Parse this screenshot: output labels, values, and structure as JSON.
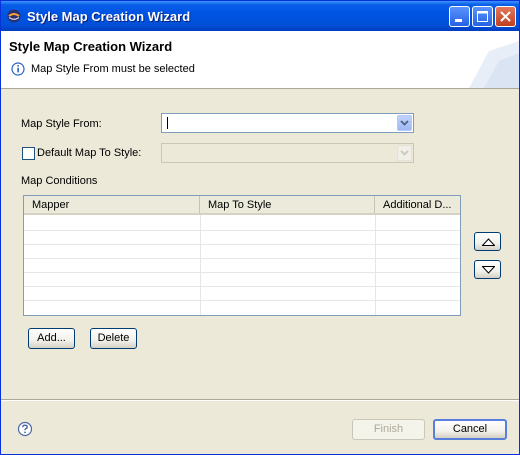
{
  "window": {
    "title": "Style Map Creation Wizard"
  },
  "header": {
    "title": "Style Map Creation Wizard",
    "message": "Map Style From must be selected"
  },
  "form": {
    "map_style_from_label": "Map Style From:",
    "map_style_from_value": "",
    "default_map_to_style_label": "Default Map To Style:",
    "default_map_to_style_checked": false,
    "map_conditions_label": "Map Conditions"
  },
  "table": {
    "columns": [
      "Mapper",
      "Map To Style",
      "Additional D..."
    ],
    "rows": []
  },
  "buttons": {
    "add": "Add...",
    "delete": "Delete",
    "finish": "Finish",
    "cancel": "Cancel"
  },
  "colors": {
    "titlebar": "#0054e3",
    "dialog_bg": "#ece9d8",
    "header_bg": "#ffffff",
    "info_blue": "#2a63c4"
  },
  "icons": [
    "app-icon",
    "minimize-icon",
    "maximize-icon",
    "close-icon",
    "info-icon",
    "chevron-down-icon",
    "move-up-icon",
    "move-down-icon",
    "help-icon"
  ]
}
